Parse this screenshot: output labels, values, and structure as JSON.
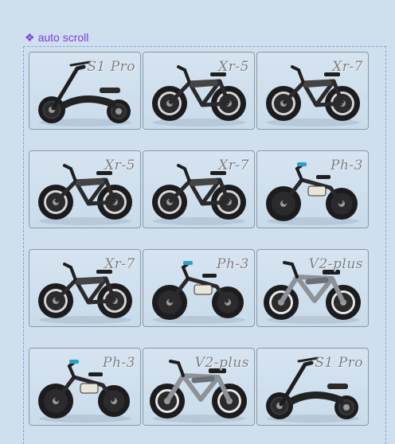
{
  "header": {
    "icon": "diamond-cluster-icon",
    "label": "auto scroll"
  },
  "colors": {
    "background": "#cfdfee",
    "accent": "#7d3dd6",
    "card_border": "#8a99a6"
  },
  "products": [
    {
      "label": "S1 Pro",
      "model": "scooter"
    },
    {
      "label": "Xr-5",
      "model": "ebike"
    },
    {
      "label": "Xr-7",
      "model": "ebike"
    },
    {
      "label": "Xr-5",
      "model": "ebike"
    },
    {
      "label": "Xr-7",
      "model": "ebike"
    },
    {
      "label": "Ph-3",
      "model": "kids"
    },
    {
      "label": "Xr-7",
      "model": "ebike"
    },
    {
      "label": "Ph-3",
      "model": "kids"
    },
    {
      "label": "V2-plus",
      "model": "cruiser"
    },
    {
      "label": "Ph-3",
      "model": "kids"
    },
    {
      "label": "V2-plus",
      "model": "cruiser"
    },
    {
      "label": "S1 Pro",
      "model": "scooter"
    }
  ]
}
